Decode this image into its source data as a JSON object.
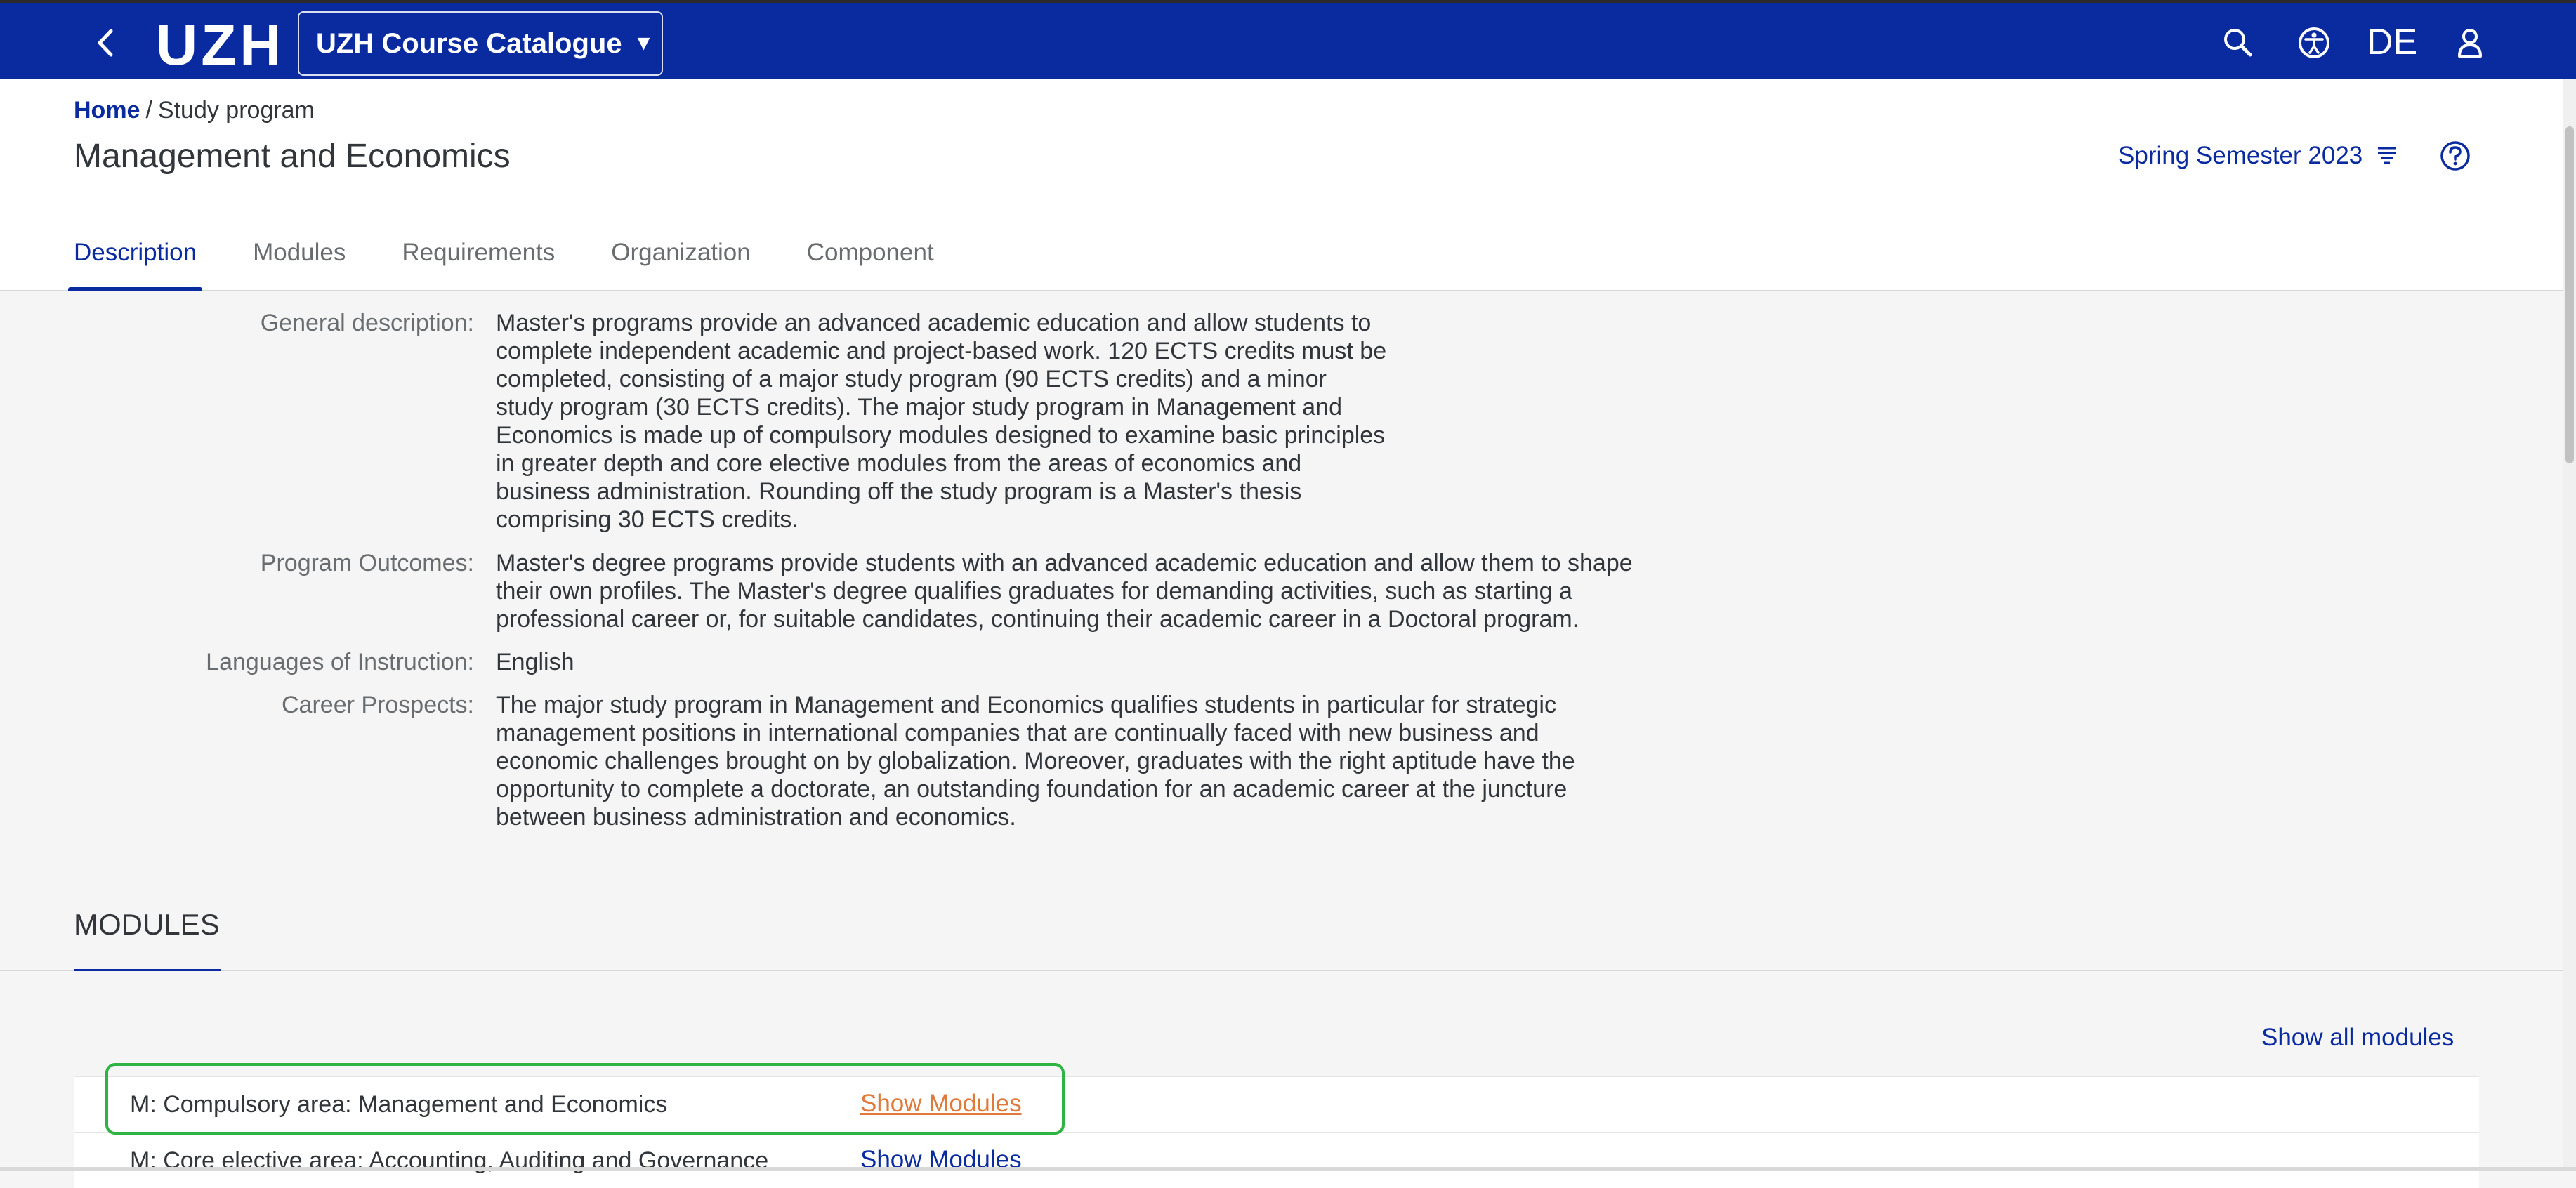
{
  "header": {
    "logo": "UZH",
    "catalogue_label": "UZH Course Catalogue",
    "language": "DE",
    "icons": [
      "chevron-left-icon",
      "search-icon",
      "accessibility-icon",
      "user-icon"
    ],
    "bar_color": "#0a2aa0"
  },
  "breadcrumb": {
    "home": "Home",
    "separator": "/",
    "current": "Study program"
  },
  "page": {
    "title": "Management and Economics",
    "semester": "Spring Semester 2023"
  },
  "tabs": [
    {
      "label": "Description",
      "active": true
    },
    {
      "label": "Modules",
      "active": false
    },
    {
      "label": "Requirements",
      "active": false
    },
    {
      "label": "Organization",
      "active": false
    },
    {
      "label": "Component",
      "active": false
    }
  ],
  "description": {
    "general_label": "General description:",
    "general_text": "Master's programs provide an advanced academic education and allow students to\ncomplete independent academic and project-based work. 120 ECTS credits must be\ncompleted, consisting of a major study program (90 ECTS credits) and a minor\nstudy program (30 ECTS credits). The major study program in Management and\nEconomics is made up of compulsory modules designed to examine basic principles\nin greater depth and core elective modules from the areas of economics and\nbusiness administration. Rounding off the study program is a Master's thesis\ncomprising 30 ECTS credits.",
    "outcomes_label": "Program Outcomes:",
    "outcomes_text": "Master's degree programs provide students with an advanced academic education and allow them to shape\ntheir own profiles. The Master's degree qualifies graduates for demanding activities, such as starting a\nprofessional career or, for suitable candidates, continuing their academic career in a Doctoral program.",
    "languages_label": "Languages of Instruction:",
    "languages_text": "English",
    "career_label": "Career Prospects:",
    "career_text": "The major study program in Management and Economics qualifies students in particular for strategic\nmanagement positions in international companies that are continually faced with new business and\neconomic challenges brought on by globalization. Moreover, graduates with the right aptitude have the\nopportunity to complete a doctorate, an outstanding foundation for an academic career at the juncture\nbetween business administration and economics."
  },
  "modules": {
    "heading": "MODULES",
    "show_all": "Show all modules",
    "rows": [
      {
        "name": "M: Compulsory area: Management and Economics",
        "link": "Show Modules"
      },
      {
        "name": "M: Core elective area: Accounting, Auditing and Governance",
        "link": "Show Modules"
      }
    ]
  }
}
